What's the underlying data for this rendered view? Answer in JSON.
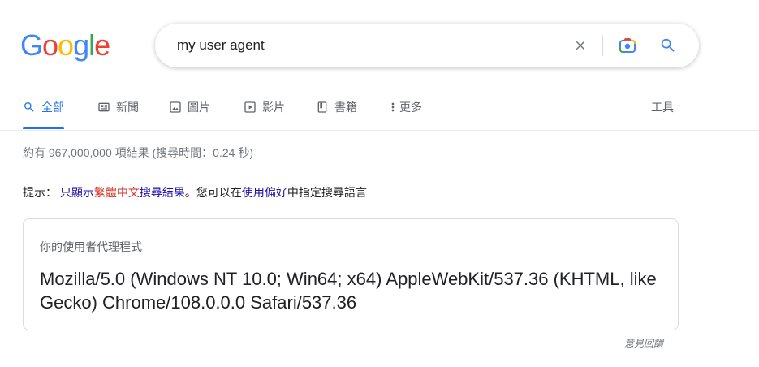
{
  "logo": {
    "letters": [
      "G",
      "o",
      "o",
      "g",
      "l",
      "e"
    ],
    "colors": [
      "#4285f4",
      "#ea4335",
      "#fbbc05",
      "#4285f4",
      "#34a853",
      "#ea4335"
    ]
  },
  "search": {
    "query": "my user agent",
    "clear_icon": "close-icon",
    "lens_icon": "camera-lens-icon",
    "search_icon": "search-icon"
  },
  "tabs": [
    {
      "label": "全部",
      "icon": "search-icon",
      "active": true
    },
    {
      "label": "新聞",
      "icon": "news-icon",
      "active": false
    },
    {
      "label": "圖片",
      "icon": "image-icon",
      "active": false
    },
    {
      "label": "影片",
      "icon": "video-icon",
      "active": false
    },
    {
      "label": "書籍",
      "icon": "book-icon",
      "active": false
    },
    {
      "label": "更多",
      "icon": "more-vert-icon",
      "active": false
    }
  ],
  "tools_label": "工具",
  "stats": "約有 967,000,000 項結果 (搜尋時間：0.24 秒)",
  "tip": {
    "prefix": "提示：",
    "link1_a": "只顯示",
    "link1_red": "繁體中文",
    "link1_b": "搜尋結果",
    "middle": "。您可以在",
    "link2": "使用偏好",
    "suffix": "中指定搜尋語言"
  },
  "card": {
    "label": "你的使用者代理程式",
    "value": "Mozilla/5.0 (Windows NT 10.0; Win64; x64) AppleWebKit/537.36 (KHTML, like Gecko) Chrome/108.0.0.0 Safari/537.36"
  },
  "feedback": "意見回饋",
  "colors": {
    "accent": "#1a73e8",
    "link": "#1a0dab",
    "highlight": "#d93025"
  }
}
